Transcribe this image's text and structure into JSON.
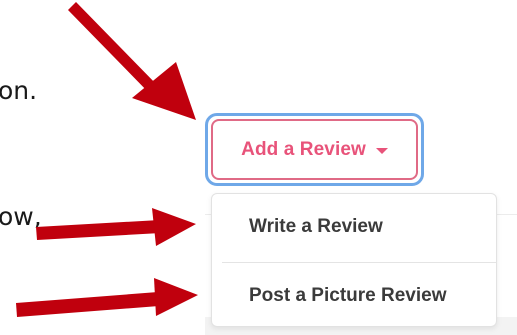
{
  "intro": {
    "line1": "on.",
    "line2": "ow,"
  },
  "button": {
    "label": "Add a Review",
    "text_color": "#e8537a",
    "focus_ring_color": "#6fa8e8"
  },
  "dropdown": {
    "items": [
      {
        "label": "Write a Review"
      },
      {
        "label": "Post a Picture Review"
      }
    ]
  },
  "annotations": {
    "arrow_color": "#c0000d",
    "icons": [
      "down-right-arrow-icon",
      "right-arrow-icon",
      "right-arrow-icon"
    ]
  }
}
